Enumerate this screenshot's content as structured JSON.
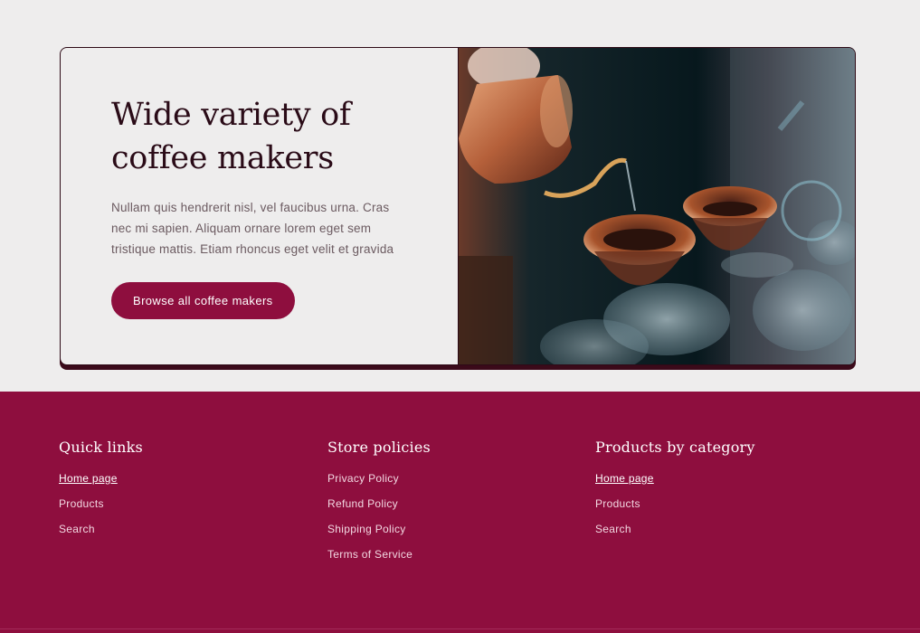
{
  "hero": {
    "title": "Wide variety of coffee makers",
    "description": "Nullam quis hendrerit nisl, vel faucibus urna. Cras nec mi sapien. Aliquam ornare lorem eget sem tristique mattis. Etiam rhoncus eget velit et gravida",
    "button_label": "Browse all coffee makers",
    "image_alt": "barista-pour-over-photo"
  },
  "footer": {
    "columns": [
      {
        "heading": "Quick links",
        "links": [
          "Home page",
          "Products",
          "Search"
        ]
      },
      {
        "heading": "Store policies",
        "links": [
          "Privacy Policy",
          "Refund Policy",
          "Shipping Policy",
          "Terms of Service"
        ]
      },
      {
        "heading": "Products by category",
        "links": [
          "Home page",
          "Products",
          "Search"
        ]
      }
    ]
  },
  "colors": {
    "background": "#eeeded",
    "brand": "#8e0e3e",
    "dark": "#2a0b17"
  }
}
